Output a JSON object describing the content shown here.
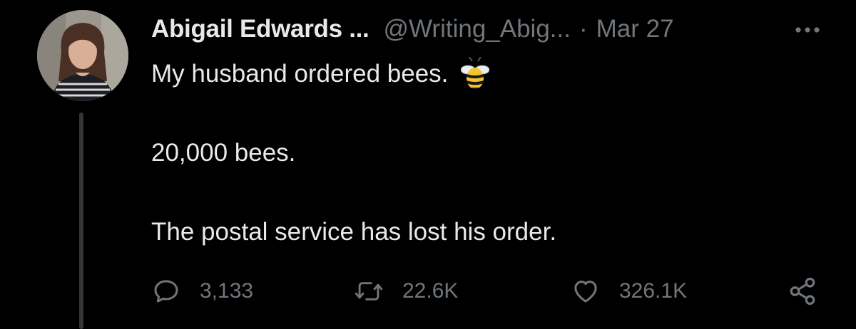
{
  "tweet": {
    "author_name": "Abigail Edwards ...",
    "author_handle": "@Writing_Abig...",
    "separator": "·",
    "date": "Mar 27",
    "lines": [
      "My husband ordered bees.",
      "20,000 bees.",
      "The postal service has lost his order."
    ],
    "emoji": "bee-emoji"
  },
  "actions": {
    "reply_count": "3,133",
    "retweet_count": "22.6K",
    "like_count": "326.1K"
  },
  "icons": {
    "more": "more-icon",
    "reply": "reply-icon",
    "retweet": "retweet-icon",
    "like": "heart-icon",
    "share": "share-icon"
  },
  "colors": {
    "background": "#000000",
    "text": "#e7e9ea",
    "secondary": "#71767b",
    "thread_line": "#333639"
  }
}
